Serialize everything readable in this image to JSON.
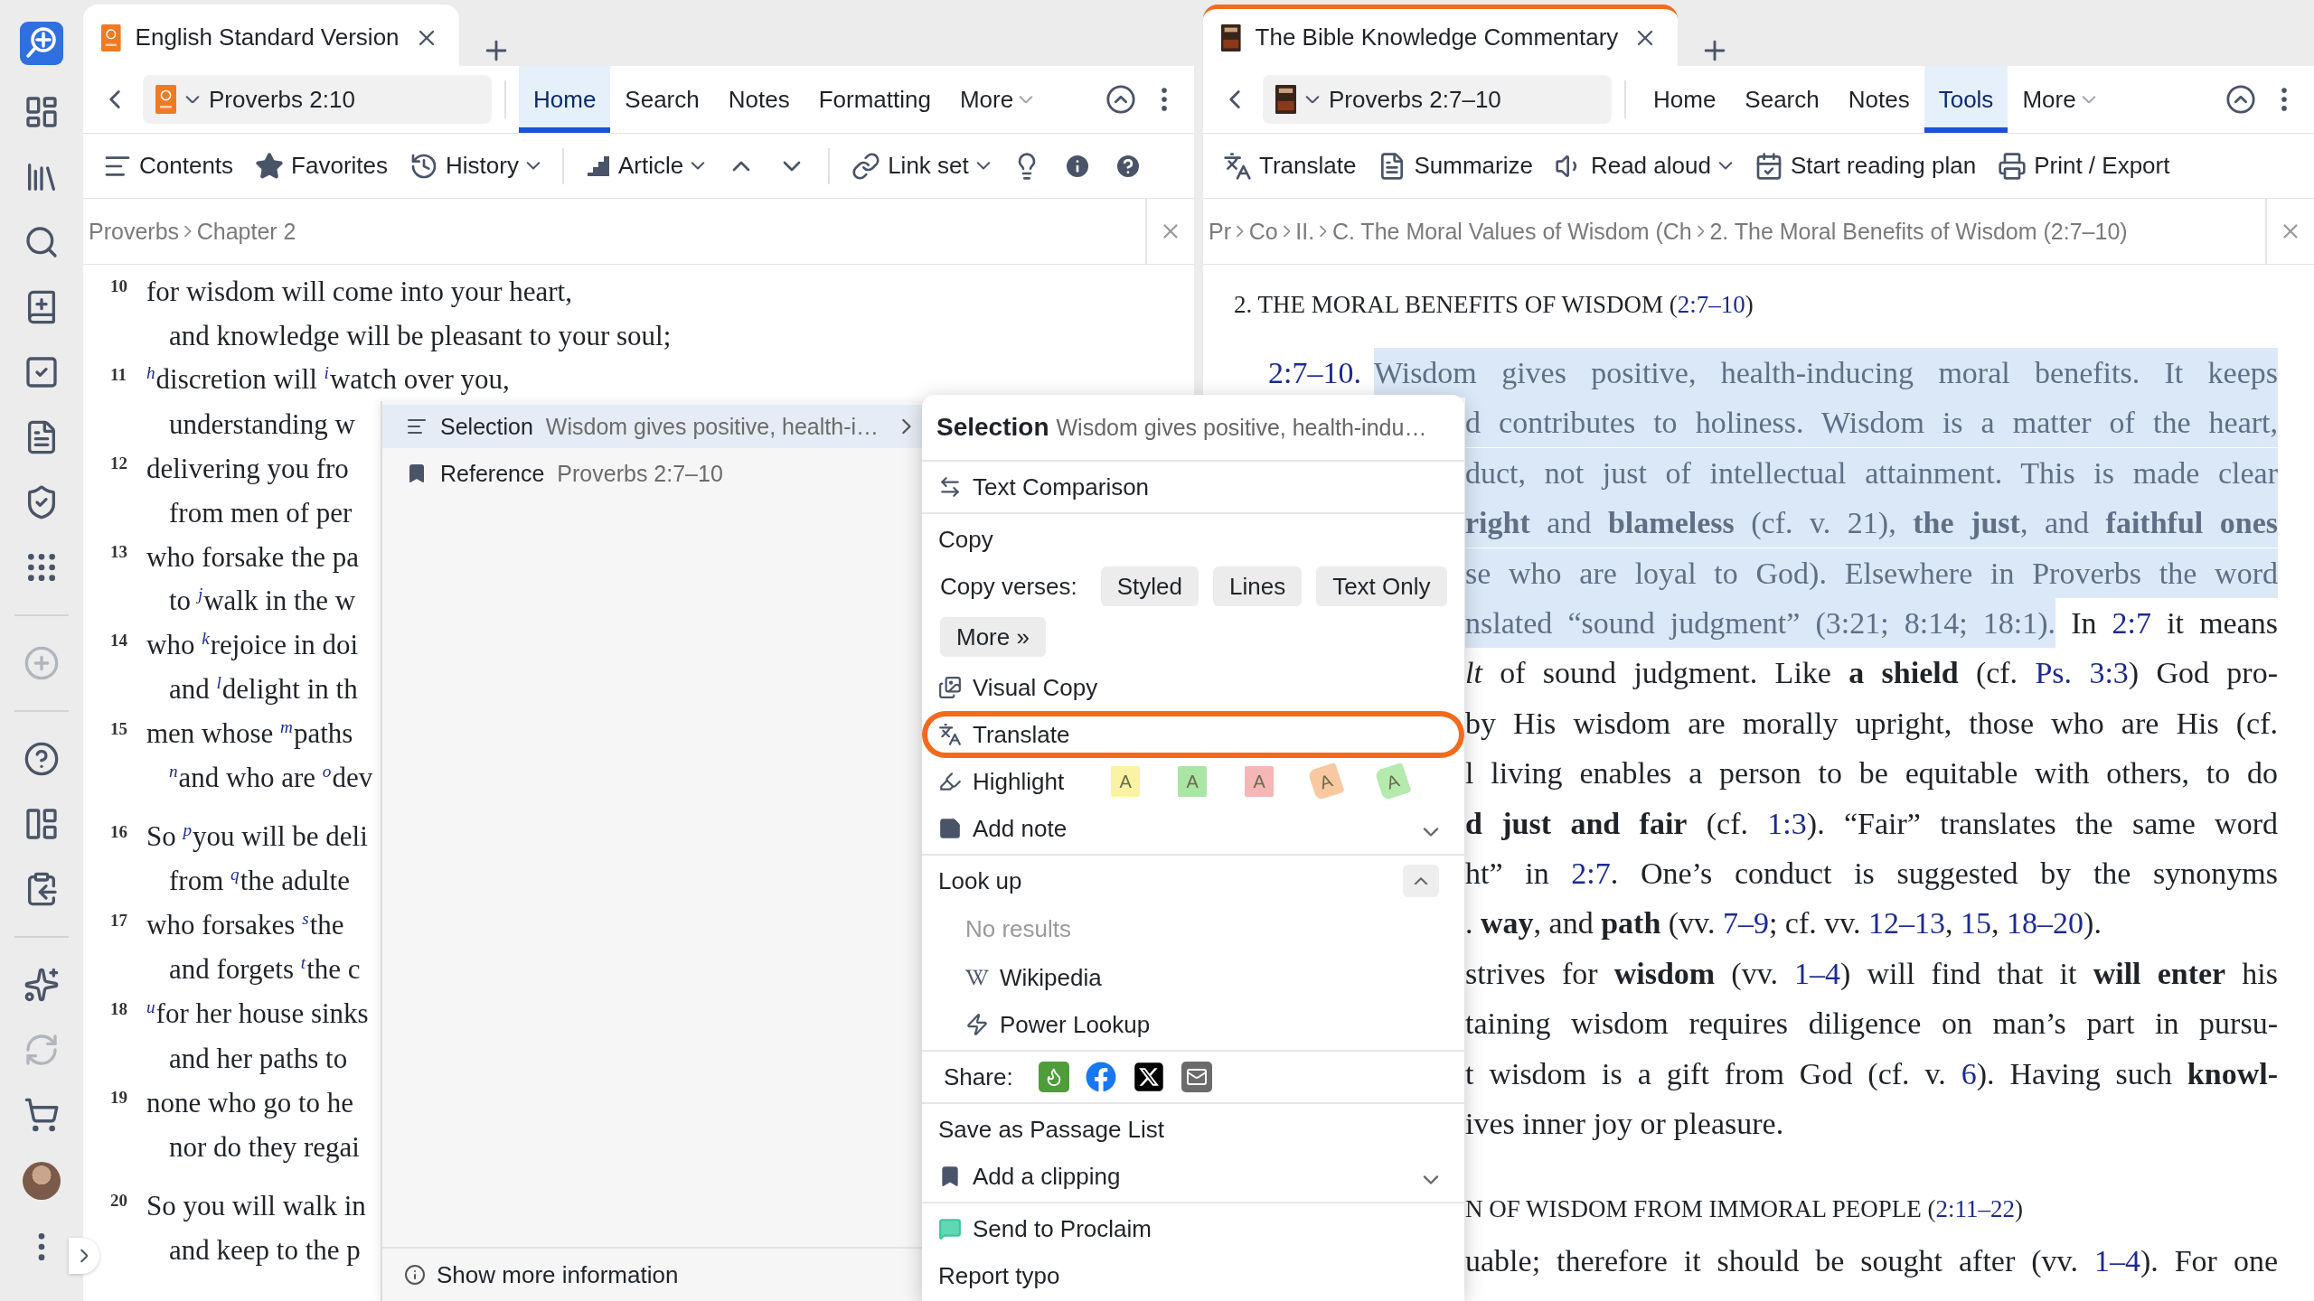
{
  "panes": [
    {
      "active": false,
      "title": "English Standard Version",
      "reference": "Proverbs 2:10",
      "ribbon": [
        {
          "label": "Home",
          "selected": true,
          "dropdown": false
        },
        {
          "label": "Search",
          "selected": false,
          "dropdown": false
        },
        {
          "label": "Notes",
          "selected": false,
          "dropdown": false
        },
        {
          "label": "Formatting",
          "selected": false,
          "dropdown": false
        },
        {
          "label": "More",
          "selected": false,
          "dropdown": true
        }
      ],
      "tools": [
        {
          "kind": "button",
          "label": "Contents",
          "dropdown": false
        },
        {
          "kind": "button",
          "label": "Favorites",
          "dropdown": false
        },
        {
          "kind": "button",
          "label": "History",
          "dropdown": true
        },
        {
          "kind": "separator"
        },
        {
          "kind": "button",
          "label": "Article",
          "dropdown": true
        },
        {
          "kind": "icon"
        },
        {
          "kind": "icon"
        },
        {
          "kind": "separator"
        },
        {
          "kind": "button",
          "label": "Link set",
          "dropdown": true
        },
        {
          "kind": "icon"
        },
        {
          "kind": "icon"
        },
        {
          "kind": "icon"
        }
      ],
      "breadcrumb": [
        "Proverbs",
        "Chapter 2"
      ],
      "stanzas": [
        [
          {
            "number": "10",
            "lines": [
              "for wisdom will come into your heart,",
              "and knowledge will be pleasant to your soul;"
            ]
          },
          {
            "number": "11",
            "lines": [
              "$^{h}$discretion will $^{i}$watch over you,",
              "understanding w"
            ]
          },
          {
            "number": "12",
            "lines": [
              "delivering you fro",
              "from men of per"
            ]
          },
          {
            "number": "13",
            "lines": [
              "who forsake the pa",
              "to $^{j}$walk in the w"
            ]
          },
          {
            "number": "14",
            "lines": [
              "who $^{k}$rejoice in doi",
              "and $^{l}$delight in th"
            ]
          },
          {
            "number": "15",
            "lines": [
              "men whose $^{m}$paths",
              "$^{n}$and who are $^{o}$dev"
            ]
          }
        ],
        [
          {
            "number": "16",
            "lines": [
              "So $^{p}$you will be deli",
              "from $^{q}$the adulte"
            ]
          },
          {
            "number": "17",
            "lines": [
              "who forsakes $^{s}$the",
              "and forgets $^{t}$the c"
            ]
          },
          {
            "number": "18",
            "lines": [
              "$^{u}$for her house sinks",
              "and her paths to"
            ]
          },
          {
            "number": "19",
            "lines": [
              "none who go to he",
              "nor do they regai"
            ]
          }
        ],
        [
          {
            "number": "20",
            "lines": [
              "So you will walk in",
              "and keep to the p"
            ]
          }
        ]
      ]
    },
    {
      "active": true,
      "title": "The Bible Knowledge Commentary",
      "reference": "Proverbs 2:7–10",
      "ribbon": [
        {
          "label": "Home",
          "selected": false,
          "dropdown": false
        },
        {
          "label": "Search",
          "selected": false,
          "dropdown": false
        },
        {
          "label": "Notes",
          "selected": false,
          "dropdown": false
        },
        {
          "label": "Tools",
          "selected": true,
          "dropdown": false
        },
        {
          "label": "More",
          "selected": false,
          "dropdown": true
        }
      ],
      "tools": [
        {
          "kind": "button",
          "label": "Translate",
          "dropdown": false
        },
        {
          "kind": "button",
          "label": "Summarize",
          "dropdown": false
        },
        {
          "kind": "button",
          "label": "Read aloud",
          "dropdown": true
        },
        {
          "kind": "button",
          "label": "Start reading plan",
          "dropdown": false
        },
        {
          "kind": "button",
          "label": "Print / Export",
          "dropdown": false
        }
      ],
      "breadcrumb": [
        "Pr",
        "Co",
        "II.",
        "C. The Moral Values of Wisdom (Ch",
        "2. The Moral Benefits of Wisdom (2:7–10)"
      ],
      "commentary": {
        "heading": [
          {
            "t": "2. THE MORAL BENEFITS OF WISDOM (",
            "kind": "plain",
            "sel": false
          },
          {
            "t": "2:7–10",
            "kind": "reference",
            "sel": false
          },
          {
            "t": ")",
            "kind": "plain",
            "sel": false
          }
        ],
        "lead": [
          {
            "t": "2:7–10.",
            "kind": "reference",
            "sel": false
          },
          {
            "t": "Wisdom gives positive, health-inducing moral benefits. It keeps",
            "kind": "plain",
            "sel": true
          }
        ],
        "paragraphs": [
          [
            [
              {
                "t": "d contributes to holiness. Wisdom is a matter of the heart,",
                "kind": "plain",
                "sel": true
              }
            ],
            [
              {
                "t": "duct, not just of intellectual attainment. This is made clear",
                "kind": "plain",
                "sel": true
              }
            ],
            [
              {
                "t": "right",
                "kind": "bold",
                "sel": true
              },
              {
                "t": " and ",
                "kind": "plain",
                "sel": true
              },
              {
                "t": "blameless",
                "kind": "bold",
                "sel": true
              },
              {
                "t": " (cf. v. 21), ",
                "kind": "plain",
                "sel": true
              },
              {
                "t": "the just",
                "kind": "bold",
                "sel": true
              },
              {
                "t": ", and ",
                "kind": "plain",
                "sel": true
              },
              {
                "t": "faithful ones",
                "kind": "bold",
                "sel": true
              }
            ],
            [
              {
                "t": "se who are loyal to God). Elsewhere in Proverbs the word",
                "kind": "plain",
                "sel": true
              }
            ],
            [
              {
                "t": "nslated “sound judgment” (3:21; 8:14; 18:1).",
                "kind": "plain",
                "sel": true
              },
              {
                "t": " In ",
                "kind": "plain",
                "sel": false
              },
              {
                "t": "2:7",
                "kind": "reference",
                "sel": false
              },
              {
                "t": " it means",
                "kind": "plain",
                "sel": false
              }
            ],
            [
              {
                "t": "lt",
                "kind": "italic",
                "sel": false
              },
              {
                "t": " of sound judgment. Like ",
                "kind": "plain",
                "sel": false
              },
              {
                "t": "a shield",
                "kind": "bold",
                "sel": false
              },
              {
                "t": " (cf. ",
                "kind": "plain",
                "sel": false
              },
              {
                "t": "Ps. 3:3",
                "kind": "reference",
                "sel": false
              },
              {
                "t": ") God pro-",
                "kind": "plain",
                "sel": false
              }
            ],
            [
              {
                "t": "by His wisdom are morally upright, those who are His (cf.",
                "kind": "plain",
                "sel": false
              }
            ],
            [
              {
                "t": "l living enables a person to be equitable with others, to do",
                "kind": "plain",
                "sel": false
              }
            ],
            [
              {
                "t": "d just and fair",
                "kind": "bold",
                "sel": false
              },
              {
                "t": " (cf. ",
                "kind": "plain",
                "sel": false
              },
              {
                "t": "1:3",
                "kind": "reference",
                "sel": false
              },
              {
                "t": "). “Fair” translates the same word",
                "kind": "plain",
                "sel": false
              }
            ],
            [
              {
                "t": "ht” in ",
                "kind": "plain",
                "sel": false
              },
              {
                "t": "2:7",
                "kind": "reference",
                "sel": false
              },
              {
                "t": ". One’s conduct is suggested by the synonyms",
                "kind": "plain",
                "sel": false
              }
            ],
            [
              {
                "t": ". ",
                "kind": "plain",
                "sel": false
              },
              {
                "t": "way",
                "kind": "bold",
                "sel": false
              },
              {
                "t": ", and ",
                "kind": "plain",
                "sel": false
              },
              {
                "t": "path",
                "kind": "bold",
                "sel": false
              },
              {
                "t": " (vv. ",
                "kind": "plain",
                "sel": false
              },
              {
                "t": "7–9",
                "kind": "reference",
                "sel": false
              },
              {
                "t": "; cf. vv. ",
                "kind": "plain",
                "sel": false
              },
              {
                "t": "12–13",
                "kind": "reference",
                "sel": false
              },
              {
                "t": ", ",
                "kind": "plain",
                "sel": false
              },
              {
                "t": "15",
                "kind": "reference",
                "sel": false
              },
              {
                "t": ", ",
                "kind": "plain",
                "sel": false
              },
              {
                "t": "18–20",
                "kind": "reference",
                "sel": false
              },
              {
                "t": ").",
                "kind": "plain",
                "sel": false
              }
            ]
          ],
          [
            [
              {
                "t": "strives for ",
                "kind": "plain",
                "sel": false
              },
              {
                "t": "wisdom",
                "kind": "bold",
                "sel": false
              },
              {
                "t": " (vv. ",
                "kind": "plain",
                "sel": false
              },
              {
                "t": "1–4",
                "kind": "reference",
                "sel": false
              },
              {
                "t": ") will find that it ",
                "kind": "plain",
                "sel": false
              },
              {
                "t": "will enter",
                "kind": "bold",
                "sel": false
              },
              {
                "t": " his",
                "kind": "plain",
                "sel": false
              }
            ],
            [
              {
                "t": "taining wisdom requires diligence on man’s part in pursu-",
                "kind": "plain",
                "sel": false
              }
            ],
            [
              {
                "t": "t wisdom is a gift from God (cf. v. ",
                "kind": "plain",
                "sel": false
              },
              {
                "t": "6",
                "kind": "reference",
                "sel": false
              },
              {
                "t": "). Having such ",
                "kind": "plain",
                "sel": false
              },
              {
                "t": "knowl-",
                "kind": "bold",
                "sel": false
              }
            ],
            [
              {
                "t": "ives inner joy or pleasure.",
                "kind": "plain",
                "sel": false
              }
            ]
          ]
        ],
        "heading_2": [
          {
            "t": "N OF WISDOM FROM IMMORAL PEOPLE (",
            "kind": "plain",
            "sel": false
          },
          {
            "t": "2:11–22",
            "kind": "reference",
            "sel": false
          },
          {
            "t": ")",
            "kind": "plain",
            "sel": false
          }
        ],
        "tail": [
          {
            "t": "uable; therefore it should be sought after (vv. ",
            "kind": "plain",
            "sel": false
          },
          {
            "t": "1–4",
            "kind": "reference",
            "sel": false
          },
          {
            "t": "). For one",
            "kind": "plain",
            "sel": false
          }
        ]
      }
    }
  ],
  "info_popup": {
    "rows": [
      {
        "label": "Selection",
        "value": "Wisdom gives positive, health-i…",
        "selected": true,
        "submenu": true
      },
      {
        "label": "Reference",
        "value": "Proverbs 2:7–10",
        "selected": false,
        "submenu": false
      }
    ],
    "footer": "Show more information"
  },
  "context_menu": {
    "title": "Selection",
    "summary": "Wisdom gives positive, health-indu…",
    "sections": [
      [
        {
          "kind": "action",
          "label": "Text Comparison",
          "circled": false
        }
      ],
      [
        {
          "kind": "plain",
          "label": "Copy",
          "circled": false
        },
        {
          "kind": "copy_verses",
          "label": "Copy verses:",
          "buttons": [
            "Styled",
            "Lines",
            "Text Only",
            "More »"
          ],
          "circled": false
        },
        {
          "kind": "action",
          "label": "Visual Copy",
          "circled": false
        },
        {
          "kind": "action",
          "label": "Translate",
          "circled": true
        },
        {
          "kind": "highlight",
          "label": "Highlight",
          "circled": false,
          "swatches": [
            {
              "label": "A",
              "color": "#fbf3a4",
              "kind": "square"
            },
            {
              "label": "A",
              "color": "#a9e6a4",
              "kind": "square"
            },
            {
              "label": "A",
              "color": "#f5b6b6",
              "kind": "square"
            },
            {
              "label": "A",
              "color": "#f8c9a0",
              "kind": "tag"
            },
            {
              "label": "A",
              "color": "#b4eaae",
              "kind": "tag"
            }
          ]
        },
        {
          "kind": "expandable",
          "label": "Add note",
          "expanded": false,
          "circled": false
        }
      ],
      [
        {
          "kind": "expandable_header",
          "label": "Look up",
          "expanded": true,
          "circled": false
        },
        {
          "kind": "muted",
          "label": "No results",
          "circled": false
        },
        {
          "kind": "sub",
          "label": "Wikipedia",
          "circled": false
        },
        {
          "kind": "sub",
          "label": "Power Lookup",
          "circled": false
        }
      ],
      [
        {
          "kind": "share",
          "label": "Share:",
          "circled": false
        }
      ],
      [
        {
          "kind": "plain",
          "label": "Save as Passage List",
          "circled": false
        },
        {
          "kind": "expandable",
          "label": "Add a clipping",
          "expanded": false,
          "circled": false
        }
      ],
      [
        {
          "kind": "action",
          "label": "Send to Proclaim",
          "circled": false
        },
        {
          "kind": "plain",
          "label": "Report typo",
          "circled": false
        }
      ]
    ]
  }
}
